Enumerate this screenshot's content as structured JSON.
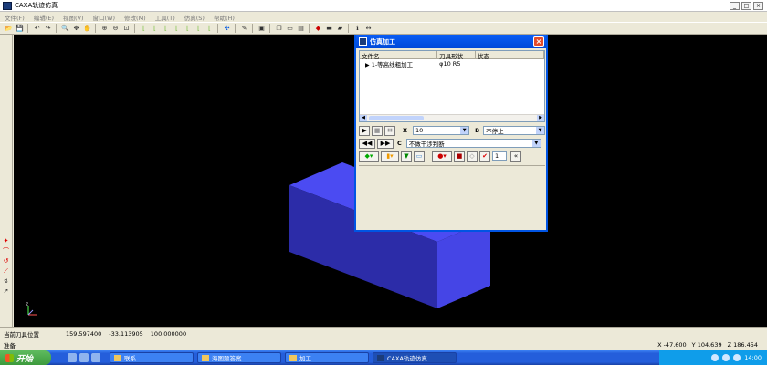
{
  "window": {
    "title": "CAXA轨迹仿真",
    "controls": [
      "_",
      "□",
      "×"
    ]
  },
  "menu": [
    "文件(F)",
    "编辑(E)",
    "视图(V)",
    "窗口(W)",
    "修改(M)",
    "工具(T)",
    "仿真(S)",
    "帮助(H)"
  ],
  "toolbar_icons": [
    "open-icon",
    "save-icon",
    "sep",
    "undo-icon",
    "redo-icon",
    "sep",
    "zoom-icon",
    "pan-icon",
    "hand-icon",
    "sep",
    "zoom-in-icon",
    "zoom-out-icon",
    "zoom-window-icon",
    "sep",
    "view-front-icon",
    "view-back-icon",
    "view-left-icon",
    "view-right-icon",
    "view-top-icon",
    "view-bottom-icon",
    "view-iso-icon",
    "sep",
    "move-icon",
    "sep",
    "draw-icon",
    "sep",
    "box-icon",
    "sep",
    "layer-icon",
    "window-icon",
    "panel-icon",
    "sep",
    "tool-color-icon",
    "blank-icon",
    "surface-icon",
    "sep",
    "info-icon",
    "measure-icon"
  ],
  "left_tools": [
    "point-icon",
    "arc-icon",
    "arc2-icon",
    "line-icon",
    "polyline-icon",
    "cursor-icon"
  ],
  "dialog": {
    "title": "仿真加工",
    "columns": [
      "文件名",
      "刀具形状",
      "状态"
    ],
    "rows": [
      {
        "name": "1-等高线粗加工",
        "tool": "φ10 R5",
        "status": ""
      }
    ],
    "x_label": "X",
    "x_value": "10",
    "b_label": "B",
    "b_value": "不停止",
    "c_label": "C",
    "c_value": "不做干涉判断",
    "step_value": "1"
  },
  "status": {
    "pos_label": "当前刀具位置",
    "pos_x": "159.597400",
    "pos_y": "-33.113905",
    "pos_z": "100.000000",
    "ready": "准备",
    "coord_x": "X  -47.600",
    "coord_y": "Y  104.639",
    "coord_z": "Z  186.454"
  },
  "taskbar": {
    "start": "开始",
    "tasks": [
      "联系",
      "海图题答案",
      "加工",
      "CAXA轨迹仿真"
    ],
    "active_task": 3,
    "clock": "14:00"
  },
  "colors": {
    "block_top": "#4b4bf2",
    "block_front": "#2f2fb8",
    "block_side": "#4040e0",
    "viewport": "#000000"
  }
}
